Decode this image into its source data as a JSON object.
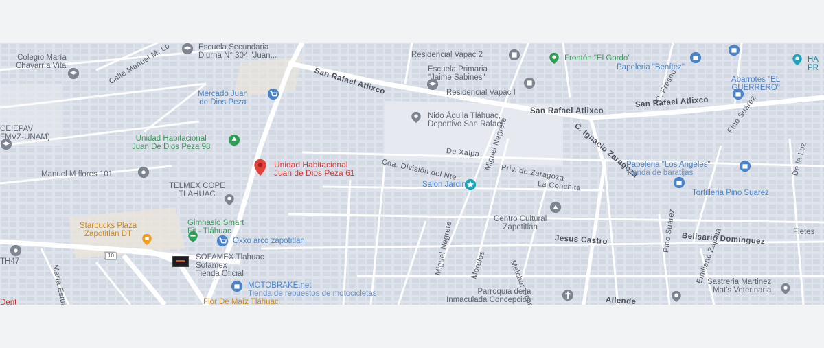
{
  "map": {
    "colors": {
      "background": "#dfe3ec",
      "road": "#ffffff",
      "block": "#cfd5df",
      "accent_red": "#e2403a",
      "blue": "#4a83c8",
      "green": "#2f9e55",
      "orange": "#f0a020",
      "gray": "#7d8590"
    },
    "highlight": {
      "name_line1": "Unidad Habitacional",
      "name_line2": "Juan de Dios Peza 61",
      "icon": "red-location-pin-icon"
    },
    "places": {
      "colegio": {
        "l1": "Colegio María",
        "l2": "Chavarría Vital",
        "icon": "school-icon"
      },
      "escuela_sec": {
        "l1": "Escuela Secundaria",
        "l2": "Diurna N° 304 \"Juan...",
        "icon": "school-icon"
      },
      "residencial2": {
        "l1": "Residencial Vapac 2",
        "icon": "building-icon"
      },
      "fronton": {
        "l1": "Frontón \"El Gordo\"",
        "icon": "sports-icon"
      },
      "papeleria_benitez": {
        "l1": "Papeleria \"Benítez\"",
        "icon": "shopping-icon"
      },
      "ha": {
        "l1": "HA",
        "l2": "PR",
        "icon": "service-icon"
      },
      "escuela_prim": {
        "l1": "Escuela Primaria",
        "l2": "\"Jaime Sabines\"",
        "icon": "school-icon"
      },
      "residencial1": {
        "l1": "Residencial Vapac I",
        "icon": "building-icon"
      },
      "abarrotes": {
        "l1": "Abarrotes \"EL",
        "l2": "GUERRERO\"",
        "icon": "shopping-icon"
      },
      "mercado": {
        "l1": "Mercado Juan",
        "l2": "de Dios Peza",
        "icon": "shopping-cart-icon"
      },
      "nido": {
        "l1": "Nido Águila Tláhuac,",
        "l2": "Deportivo San Rafael",
        "icon": "place-icon"
      },
      "ceiepav": {
        "l1": "CEIEPAV",
        "l2": "FMVZ-UNAM)",
        "icon": "school-icon"
      },
      "unidad98": {
        "l1": "Unidad Habitacional",
        "l2": "Juan De Dios Peza 98",
        "icon": "park-icon"
      },
      "manuel_flores": {
        "l1": "Manuel M flores 101",
        "icon": "place-icon"
      },
      "telmex": {
        "l1": "TELMEX COPE",
        "l2": "TLAHUAC",
        "icon": "place-icon"
      },
      "papeleria_angeles": {
        "l1": "Papeleria \"Los Angeles\"",
        "l2": "Tienda de baratijas",
        "icon": "shopping-icon"
      },
      "salon": {
        "l1": "Salon Jardin",
        "icon": "event-icon"
      },
      "tortilleria": {
        "l1": "Tortilleria Pino Suarez",
        "icon": "shopping-icon"
      },
      "starbucks": {
        "l1": "Starbucks Plaza",
        "l2": "Zapotitlán DT",
        "icon": "cafe-icon"
      },
      "gimnasio": {
        "l1": "Gimnasio Smart",
        "l2": "Fit - Tláhuac",
        "icon": "gym-icon"
      },
      "oxxo": {
        "l1": "Oxxo arco zapotitlan",
        "icon": "shopping-cart-icon"
      },
      "centro": {
        "l1": "Centro Cultural",
        "l2": "Zapotitlán",
        "icon": "place-icon"
      },
      "fletes": {
        "l1": "Fletes"
      },
      "th47": {
        "l1": "TH47",
        "icon": "place-icon"
      },
      "sofamex": {
        "l1": "SOFAMEX Tlahuac",
        "l2": "Sofamex",
        "l3": "Tienda Oficial",
        "icon": "store-logo-icon"
      },
      "motobrake": {
        "l1": "MOTOBRAKE.net",
        "l2": "Tienda de repuestos de motocicletas",
        "icon": "shopping-icon"
      },
      "parroquia": {
        "l1": "Parroquia de la",
        "l2": "Inmaculada Concepción",
        "icon": "church-icon"
      },
      "sastreria": {
        "l1": "Sastreria Martinez",
        "l2": "Mat's Veterinaria",
        "icon": "place-icon"
      },
      "flor": {
        "l1": "Flor De Maíz Tláhuac"
      },
      "dent": {
        "l1": "Dent"
      }
    },
    "streets": {
      "calle_manuel": "Calle Manuel M. Lo",
      "san_rafael_1": "San Rafael Atlixco",
      "san_rafael_2": "San Rafael Atlixco",
      "san_rafael_3": "San Rafael Atlixco",
      "c_fresno": "C. Fresno",
      "pino_suarez_ne": "Pino Suárez",
      "miguel_negrete_n": "Miguel Negrete",
      "ignacio": "C. Ignacio Zaragoza",
      "de_xalpa": "De Xalpa",
      "cda_division": "Cda. División del Nte.",
      "priv_zaragoza": "Priv. de Zaragoza",
      "la_conchita": "La Conchita",
      "de_la_luz": "De la Luz",
      "jesus_castro": "Jesus Castro",
      "belisario": "Belisario Domínguez",
      "pino_suarez_s": "Pino Suárez",
      "emiliano": "Emiliano Zapata",
      "miguel_negrete_s": "Miguel Negrete",
      "morelos": "Morelos",
      "melchor": "Melchor Ocampo",
      "maria_estuardo": "María Estuardo",
      "allende": "Allende",
      "route_10": "10"
    }
  }
}
